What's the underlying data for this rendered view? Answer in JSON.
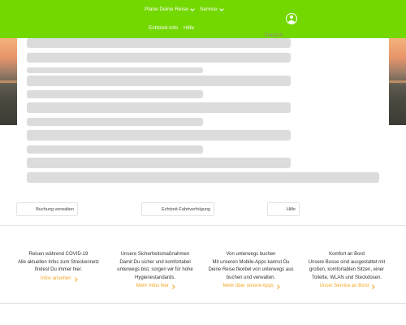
{
  "header": {
    "brand_color": "#73d700",
    "nav": [
      {
        "label": "Plane Deine Reise",
        "has_dropdown": true
      },
      {
        "label": "Service",
        "has_dropdown": true
      },
      {
        "label": "Echtzeit-Info",
        "has_dropdown": false
      },
      {
        "label": "Hilfe",
        "has_dropdown": false
      }
    ],
    "language": "Deutsch",
    "account_icon": "user-circle-icon"
  },
  "loading_state": "skeleton-placeholder",
  "actions": {
    "manage_booking": "Buchung verwalten",
    "tracking": "Echtzeit-Fahrtverfolgung",
    "help": "Hilfe"
  },
  "info_columns": [
    {
      "title": "Reisen während COVID-19",
      "text": "Alle aktuellen Infos zum Streckennetz findest Du immer hier.",
      "link": "Infos ansehen"
    },
    {
      "title": "Unsere Sicherheitsmaßnahmen",
      "text": "Damit Du sicher und komfortabel unterwegs bist, sorgen wir für hohe Hygienestandards.",
      "link": "Mehr Infos hier"
    },
    {
      "title": "Von unterwegs buchen",
      "text": "Mit unseren Mobile-Apps kannst Du Deine Reise flexibel von unterwegs aus buchen und verwalten.",
      "link": "Mehr über unsere Apps"
    },
    {
      "title": "Komfort an Bord",
      "text": "Unsere Busse sind ausgestattet mit großen, komfortablen Sitzen, einer Toilette, WLAN und Steckdosen.",
      "link": "Unser Service an Bord"
    }
  ],
  "accent_link_color": "#f5a623"
}
